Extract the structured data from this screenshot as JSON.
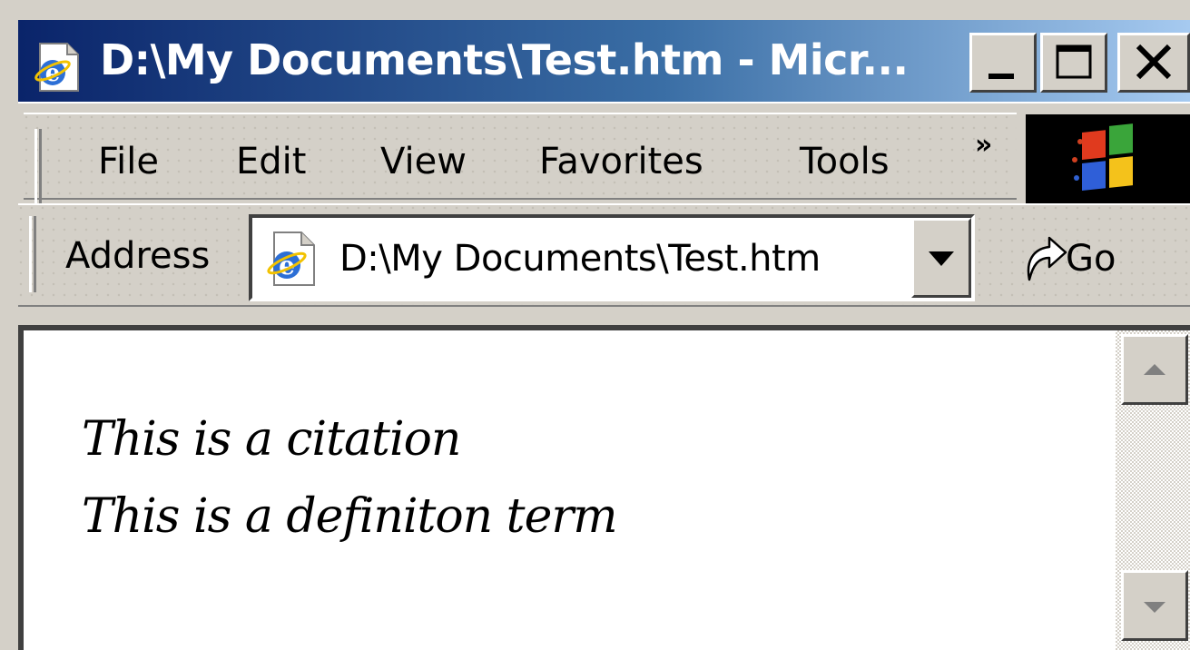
{
  "window": {
    "title": "D:\\My Documents\\Test.htm - Micr..."
  },
  "menu": {
    "items": [
      "File",
      "Edit",
      "View",
      "Favorites",
      "Tools"
    ],
    "overflow": "»"
  },
  "address": {
    "label": "Address",
    "value": "D:\\My Documents\\Test.htm",
    "go_label": "Go"
  },
  "content": {
    "citation": "This is a citation",
    "definition_term": "This is a definiton term"
  },
  "icons": {
    "title": "ie-page-icon",
    "address": "ie-page-icon",
    "go": "go-arrow-icon",
    "throbber": "windows-logo-icon"
  },
  "colors": {
    "titlebar_start": "#0a246a",
    "titlebar_end": "#a6caf0",
    "chrome": "#d4d0c8",
    "content_bg": "#ffffff"
  }
}
